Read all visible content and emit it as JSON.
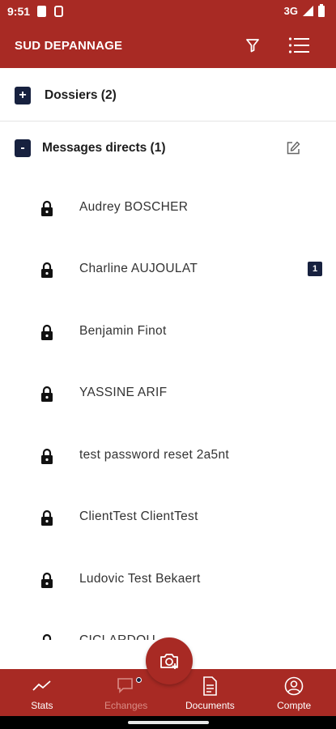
{
  "status_bar": {
    "time": "9:51",
    "network": "3G"
  },
  "app_bar": {
    "title": "SUD DEPANNAGE",
    "icons": [
      "filter-icon",
      "list-icon"
    ]
  },
  "sections": {
    "dossiers": {
      "toggle": "+",
      "label": "Dossiers (2)"
    },
    "messages": {
      "toggle": "-",
      "label": "Messages directs (1)",
      "icon": "edit-icon"
    }
  },
  "contacts": [
    {
      "name": "Audrey BOSCHER",
      "icon": "lock-icon"
    },
    {
      "name": "Charline AUJOULAT",
      "icon": "lock-icon",
      "badge": "1"
    },
    {
      "name": "Benjamin Finot",
      "icon": "lock-icon"
    },
    {
      "name": "YASSINE ARIF",
      "icon": "lock-icon"
    },
    {
      "name": "test password reset 2a5nt",
      "icon": "lock-icon"
    },
    {
      "name": "ClientTest ClientTest",
      "icon": "lock-icon"
    },
    {
      "name": "Ludovic Test Bekaert",
      "icon": "lock-icon"
    },
    {
      "name": "CICLARDOU",
      "icon": "lock-icon"
    }
  ],
  "fab": {
    "icon": "camera-add-icon"
  },
  "bottom_nav": [
    {
      "label": "Stats",
      "icon": "chart-icon"
    },
    {
      "label": "Echanges",
      "icon": "chat-icon",
      "active": true
    },
    {
      "label": "Documents",
      "icon": "document-icon"
    },
    {
      "label": "Compte",
      "icon": "account-icon"
    }
  ],
  "colors": {
    "primary": "#a82a24",
    "navy": "#17213f",
    "active_nav": "#d98c85"
  }
}
